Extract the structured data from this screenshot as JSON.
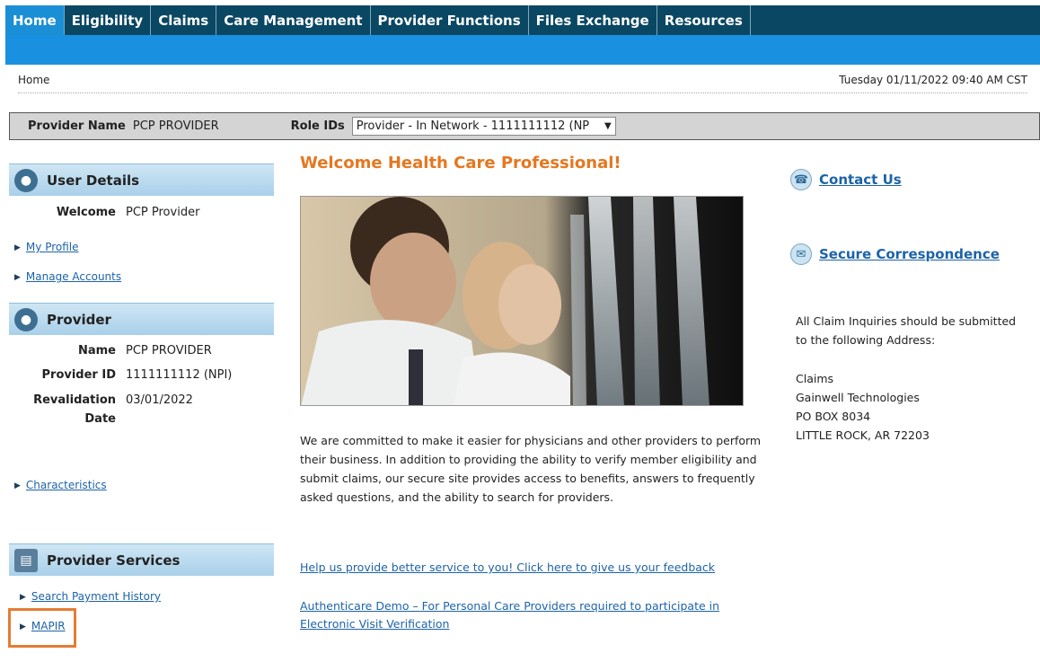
{
  "nav": {
    "tabs": [
      "Home",
      "Eligibility",
      "Claims",
      "Care Management",
      "Provider Functions",
      "Files Exchange",
      "Resources"
    ],
    "active": "Home"
  },
  "breadcrumb": "Home",
  "datetime": "Tuesday 01/11/2022 09:40 AM CST",
  "provider_bar": {
    "name_label": "Provider Name",
    "name_value": "PCP PROVIDER",
    "role_label": "Role IDs",
    "role_selected": "Provider - In Network - 1111111112 (NP"
  },
  "user_details": {
    "title": "User Details",
    "welcome_label": "Welcome",
    "welcome_value": "PCP Provider",
    "links": [
      "My Profile",
      "Manage Accounts"
    ]
  },
  "provider": {
    "title": "Provider",
    "name_label": "Name",
    "name_value": "PCP PROVIDER",
    "id_label": "Provider ID",
    "id_value": "1111111112 (NPI)",
    "reval_label_1": "Revalidation",
    "reval_label_2": "Date",
    "reval_value": "03/01/2022",
    "characteristics_link": "Characteristics"
  },
  "provider_services": {
    "title": "Provider Services",
    "links": [
      "Search Payment History",
      "MAPIR"
    ]
  },
  "main": {
    "welcome": "Welcome Health Care Professional!",
    "intro": "We are committed to make it easier for physicians and other providers to perform their business. In addition to providing the ability to verify member eligibility and submit claims, our secure site provides access to benefits, answers to frequently asked questions, and the ability to search for providers.",
    "feedback_link": "Help us provide better service to you! Click here to give us your feedback",
    "authenticare_link": "Authenticare Demo – For Personal Care Providers required to participate in Electronic Visit Verification"
  },
  "right": {
    "contact_us": "Contact Us",
    "secure_correspondence": "Secure Correspondence",
    "claims_note_1": "All Claim Inquiries should be submitted",
    "claims_note_2": "to the following Address:",
    "address": [
      "Claims",
      "Gainwell Technologies",
      "PO BOX 8034",
      "LITTLE ROCK, AR 72203"
    ]
  },
  "colors": {
    "nav_bg": "#0a4763",
    "nav_active": "#1a8fd6",
    "blue_bar": "#1a90e0",
    "welcome_orange": "#e5771f",
    "link_blue": "#1d63a8",
    "highlight_box": "#e57c32"
  },
  "icons": {
    "user_details": "users-icon",
    "provider": "users-icon",
    "provider_services": "document-icon",
    "contact_us": "phone-icon",
    "secure_correspondence": "envelope-icon",
    "link_bullet": "triangle-right-icon",
    "select_arrow": "chevron-down-icon"
  }
}
